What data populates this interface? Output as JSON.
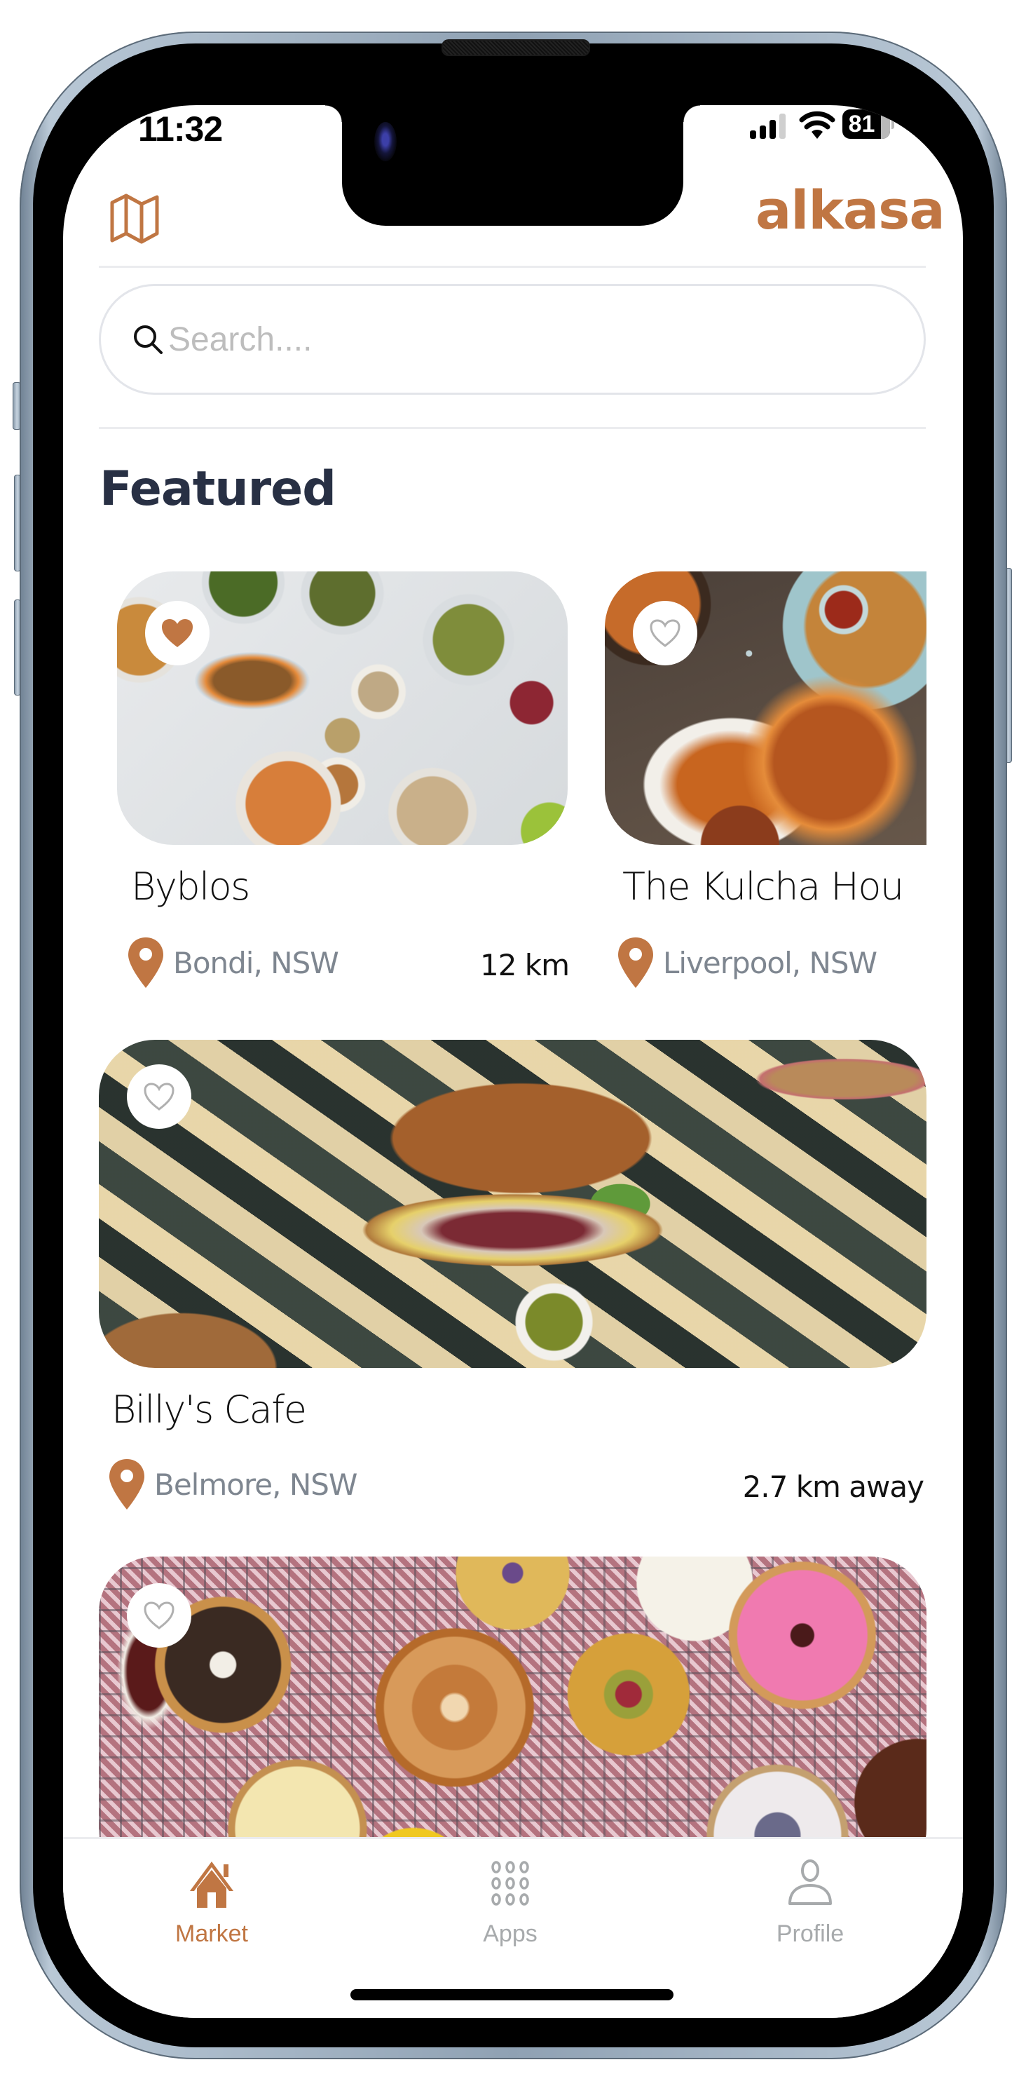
{
  "theme": {
    "accent": "#C07643",
    "heading": "#283044",
    "muted_text": "#7E8690",
    "inactive_tab": "#A7AAAC",
    "placeholder": "#BDBDBD"
  },
  "status_bar": {
    "time": "11:32",
    "battery_percent": "81",
    "signal_bars_active": 3,
    "signal_bars_total": 4,
    "icons": [
      "cellular-signal-icon",
      "wifi-icon",
      "battery-icon"
    ]
  },
  "header": {
    "map_icon": "map-icon",
    "logo": "alkasa"
  },
  "search": {
    "icon": "search-icon",
    "value": "",
    "placeholder": "Search...."
  },
  "featured": {
    "title": "Featured",
    "carousel": [
      {
        "name": "Byblos",
        "location": "Bondi, NSW",
        "distance": "12 km",
        "favorited": true,
        "image": "Middle Eastern mezze spread with falafel, hummus and salads"
      },
      {
        "name": "The Kulcha Hou",
        "location": "Liverpool, NSW",
        "distance": "",
        "favorited": false,
        "image": "Tandoori chicken, pakoras and curry"
      }
    ],
    "list": [
      {
        "name": "Billy's Cafe",
        "location": "Belmore, NSW",
        "distance": "2.7 km away",
        "favorited": false,
        "image": "Deli sandwich on ciabatta with chips and pickles"
      },
      {
        "name": "",
        "location": "",
        "distance": "",
        "favorited": false,
        "image": "Assorted donuts and cinnamon scroll on a cooling rack"
      }
    ]
  },
  "tab_bar": {
    "tabs": [
      {
        "label": "Market",
        "icon": "home-icon",
        "active": true
      },
      {
        "label": "Apps",
        "icon": "grid-icon",
        "active": false
      },
      {
        "label": "Profile",
        "icon": "person-icon",
        "active": false
      }
    ]
  }
}
